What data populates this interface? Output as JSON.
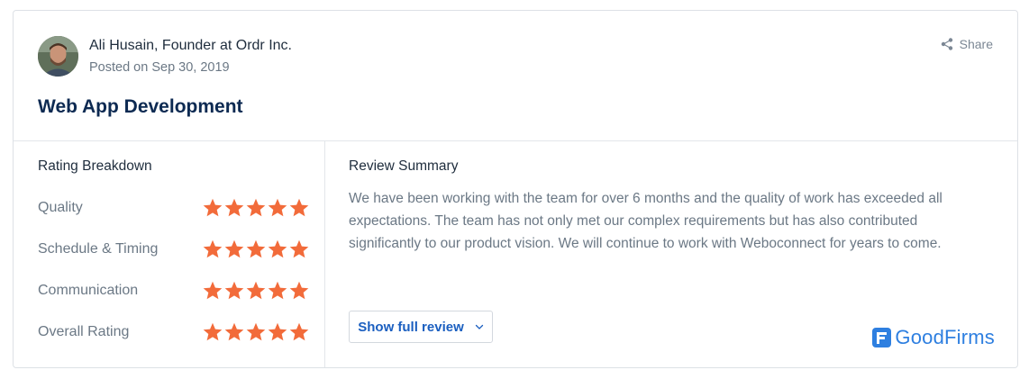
{
  "review": {
    "author": "Ali Husain, Founder at Ordr Inc.",
    "posted": "Posted on Sep 30, 2019",
    "title": "Web App Development",
    "share_label": "Share"
  },
  "rating_breakdown": {
    "heading": "Rating Breakdown",
    "star_color": "#f26b3a",
    "items": [
      {
        "label": "Quality",
        "stars": 5
      },
      {
        "label": "Schedule & Timing",
        "stars": 5
      },
      {
        "label": "Communication",
        "stars": 5
      },
      {
        "label": "Overall Rating",
        "stars": 5
      }
    ]
  },
  "summary": {
    "heading": "Review Summary",
    "text": "We have been working with the team for over 6 months and the quality of work has exceeded all expectations. The team has not only met our complex requirements but has also contributed significantly to our product vision. We will continue to work with Weboconnect for years to come.",
    "show_full_label": "Show full review"
  },
  "brand": {
    "name": "GoodFirms",
    "color": "#2e7fe0"
  },
  "icons": {
    "share": "share-icon",
    "chevron": "chevron-down-icon",
    "logo": "goodfirms-logo-icon"
  }
}
